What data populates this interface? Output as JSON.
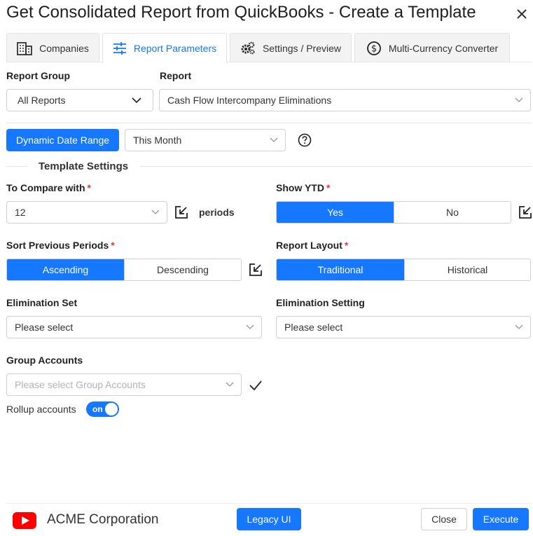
{
  "dialog": {
    "title": "Get Consolidated Report from QuickBooks - Create a Template"
  },
  "tabs": [
    {
      "label": "Companies",
      "icon": "building-icon",
      "active": false
    },
    {
      "label": "Report Parameters",
      "icon": "sliders-icon",
      "active": true
    },
    {
      "label": "Settings / Preview",
      "icon": "gears-icon",
      "active": false
    },
    {
      "label": "Multi-Currency Converter",
      "icon": "dollar-circle-icon",
      "active": false
    }
  ],
  "report_group": {
    "label": "Report Group",
    "value": "All Reports"
  },
  "report": {
    "label": "Report",
    "value": "Cash Flow Intercompany Eliminations"
  },
  "date_range": {
    "button_label": "Dynamic Date Range",
    "value": "This Month",
    "help_icon": "question-circle-icon"
  },
  "template_settings": {
    "title": "Template Settings"
  },
  "compare": {
    "label": "To Compare with",
    "required": "*",
    "value": "12",
    "suffix": "periods"
  },
  "show_ytd": {
    "label": "Show YTD",
    "required": "*",
    "options": [
      "Yes",
      "No"
    ],
    "selected": "Yes"
  },
  "sort_periods": {
    "label": "Sort Previous Periods",
    "required": "*",
    "options": [
      "Ascending",
      "Descending"
    ],
    "selected": "Ascending"
  },
  "report_layout": {
    "label": "Report Layout",
    "required": "*",
    "options": [
      "Traditional",
      "Historical"
    ],
    "selected": "Traditional"
  },
  "elimination_set": {
    "label": "Elimination Set",
    "placeholder": "Please select"
  },
  "elimination_setting": {
    "label": "Elimination Setting",
    "placeholder": "Please select"
  },
  "group_accounts": {
    "label": "Group Accounts",
    "placeholder": "Please select Group Accounts"
  },
  "rollup": {
    "label": "Rollup accounts",
    "toggle_label": "on",
    "enabled": true
  },
  "footer": {
    "company": "ACME Corporation",
    "legacy_button": "Legacy UI",
    "close_button": "Close",
    "execute_button": "Execute"
  },
  "colors": {
    "accent": "#1677ff",
    "required": "#e53935",
    "youtube": "#ff0000"
  }
}
